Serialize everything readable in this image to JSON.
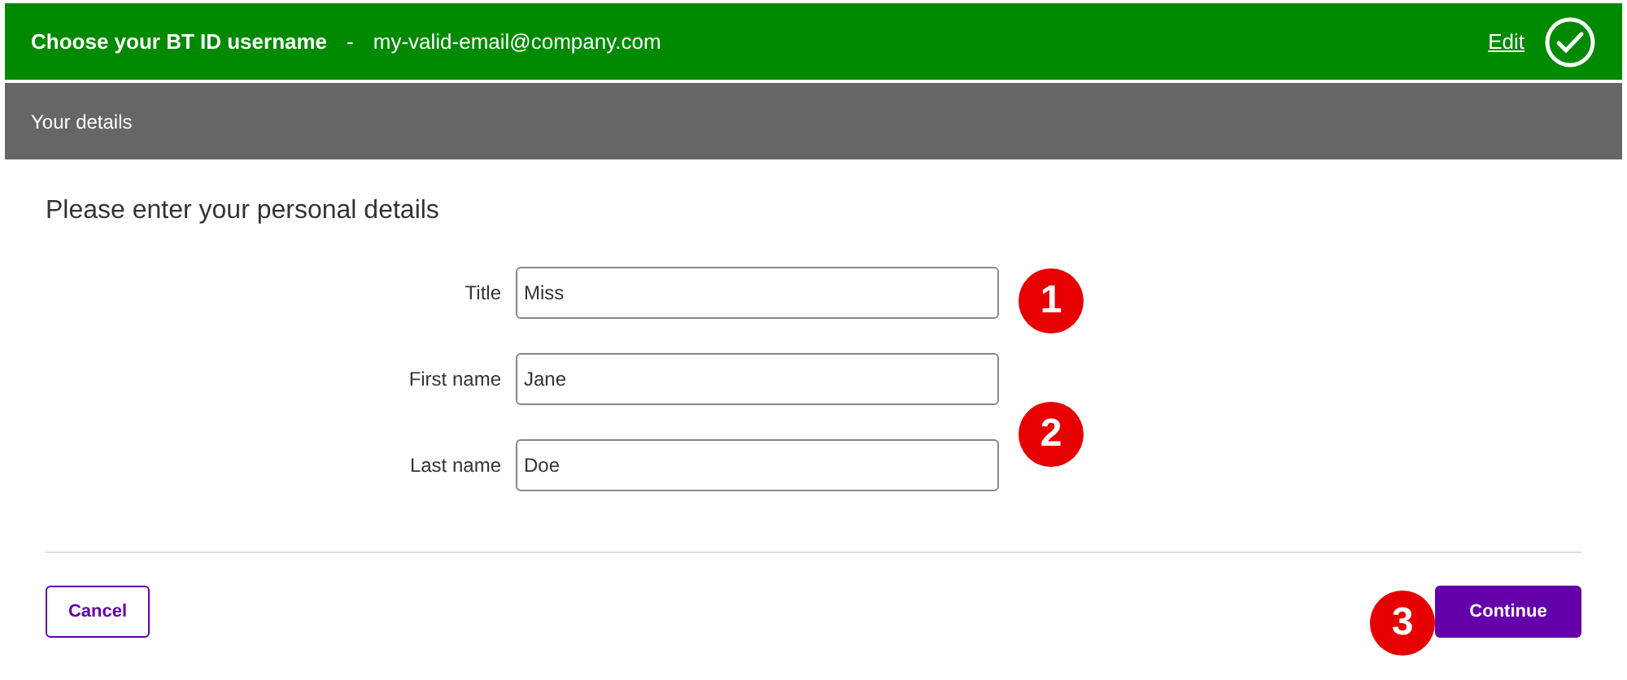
{
  "header": {
    "title": "Choose your BT ID username",
    "separator": "-",
    "value": "my-valid-email@company.com",
    "edit_link": "Edit",
    "complete": true
  },
  "section": {
    "title": "Your details"
  },
  "form": {
    "heading": "Please enter your personal details",
    "fields": [
      {
        "label": "Title",
        "value": "Miss"
      },
      {
        "label": "First name",
        "value": "Jane"
      },
      {
        "label": "Last name",
        "value": "Doe"
      }
    ]
  },
  "buttons": {
    "cancel": "Cancel",
    "continue": "Continue"
  },
  "markers": [
    "1",
    "2",
    "3"
  ]
}
